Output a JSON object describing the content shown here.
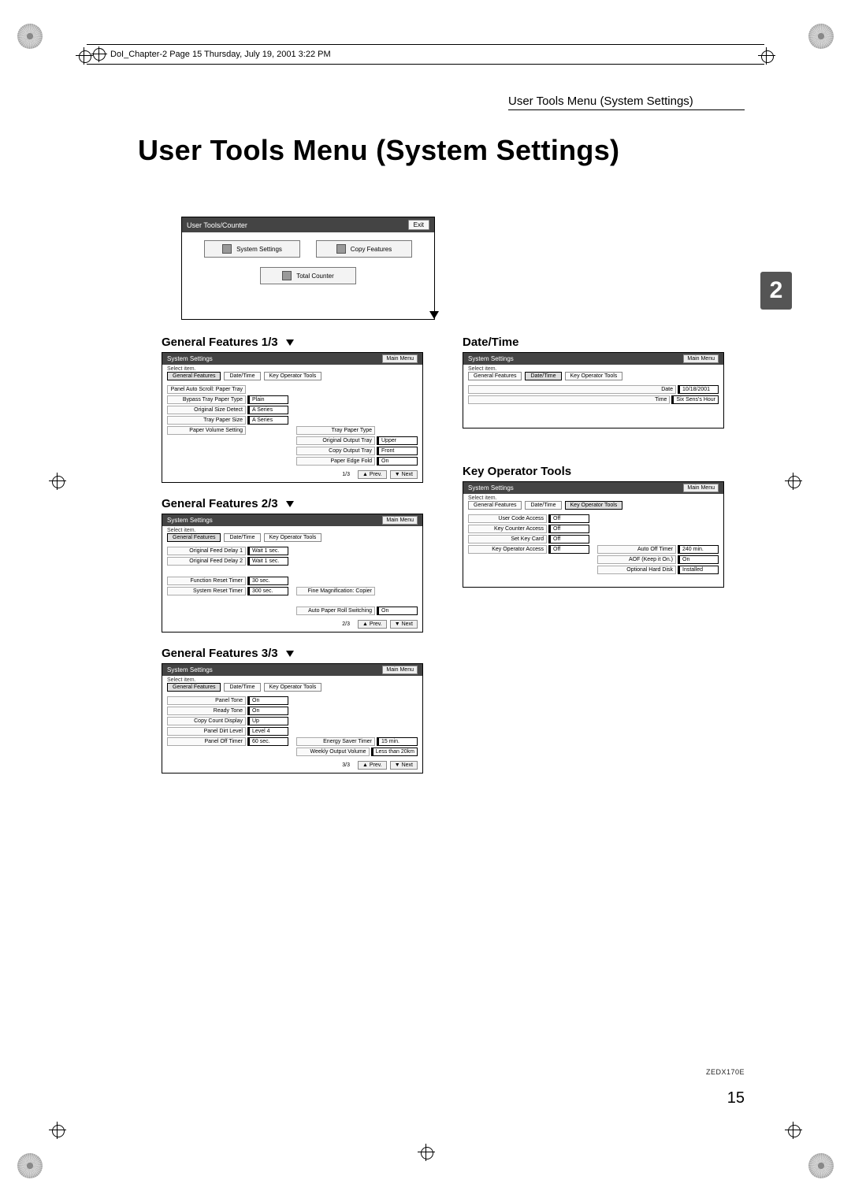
{
  "runline": "DoI_Chapter-2  Page 15  Thursday, July 19, 2001  3:22 PM",
  "section_title_small": "User Tools Menu (System Settings)",
  "page_title": "User Tools Menu (System Settings)",
  "chapter_badge": "2",
  "footer_id": "ZEDX170E",
  "page_number": "15",
  "main_screen": {
    "title": "User Tools/Counter",
    "exit": "Exit",
    "buttons": {
      "system_settings": "System Settings",
      "copy_features": "Copy Features",
      "total_counter": "Total Counter"
    }
  },
  "labels": {
    "gf1": "General Features 1/3",
    "gf2": "General Features 2/3",
    "gf3": "General Features 3/3",
    "datetime": "Date/Time",
    "keyop": "Key Operator Tools"
  },
  "common": {
    "system_settings": "System Settings",
    "main_menu": "Main Menu",
    "select_item": "Select item.",
    "tabs": {
      "general": "General Features",
      "datetime": "Date/Time",
      "keyop": "Key Operator Tools"
    },
    "nav": {
      "prev": "▲ Prev.",
      "next": "▼ Next"
    }
  },
  "gf1": {
    "page": "1/3",
    "left": [
      {
        "k": "Panel Auto Scroll: Paper Tray",
        "v": "",
        "noval": true
      },
      {
        "k": "Bypass Tray Paper Type",
        "v": "Plain"
      },
      {
        "k": "Original Size Detect",
        "v": "A Series"
      },
      {
        "k": "Tray Paper Size",
        "v": "A Series"
      },
      {
        "k": "Paper Volume Setting",
        "v": "",
        "noval": true
      }
    ],
    "right": [
      {
        "k": "Tray Paper Type",
        "v": "",
        "noval": true
      },
      {
        "k": "Original Output Tray",
        "v": "Upper"
      },
      {
        "k": "Copy Output Tray",
        "v": "Front"
      },
      {
        "k": "Paper Edge Fold",
        "v": "On"
      }
    ]
  },
  "gf2": {
    "page": "2/3",
    "left": [
      {
        "k": "Original Feed Delay 1",
        "v": "Wait 1 sec."
      },
      {
        "k": "Original Feed Delay 2",
        "v": "Wait 1 sec."
      },
      {
        "k": "",
        "v": "",
        "noval": true,
        "blank": true
      },
      {
        "k": "Function Reset Timer",
        "v": "30 sec."
      },
      {
        "k": "System Reset Timer",
        "v": "300 sec."
      }
    ],
    "right": [
      {
        "k": "Fine Magnification: Copier",
        "v": "",
        "noval": true
      },
      {
        "k": "",
        "v": "",
        "noval": true,
        "blank": true
      },
      {
        "k": "Auto Paper Roll Switching",
        "v": "On"
      }
    ]
  },
  "gf3": {
    "page": "3/3",
    "left": [
      {
        "k": "Panel Tone",
        "v": "On"
      },
      {
        "k": "Ready Tone",
        "v": "On"
      },
      {
        "k": "Copy Count Display",
        "v": "Up"
      },
      {
        "k": "Panel Dirt Level",
        "v": "Level 4"
      },
      {
        "k": "Panel Off Timer",
        "v": "60 sec."
      }
    ],
    "right": [
      {
        "k": "Energy Saver Timer",
        "v": "15 min."
      },
      {
        "k": "Weekly Output Volume",
        "v": "Less than 20km"
      }
    ]
  },
  "datetime": {
    "left": [
      {
        "k": "Date",
        "v": "10/18/2001"
      },
      {
        "k": "Time",
        "v": "Six Sens's Hour"
      }
    ]
  },
  "keyop": {
    "left": [
      {
        "k": "User Code Access",
        "v": "Off"
      },
      {
        "k": "Key Counter Access",
        "v": "Off"
      },
      {
        "k": "Set Key Card",
        "v": "Off"
      },
      {
        "k": "Key Operator Access",
        "v": "Off"
      }
    ],
    "right": [
      {
        "k": "Auto Off Timer",
        "v": "240 min."
      },
      {
        "k": "AOF (Keep it On.)",
        "v": "On"
      },
      {
        "k": "Optional Hard Disk",
        "v": "Installed"
      }
    ]
  }
}
